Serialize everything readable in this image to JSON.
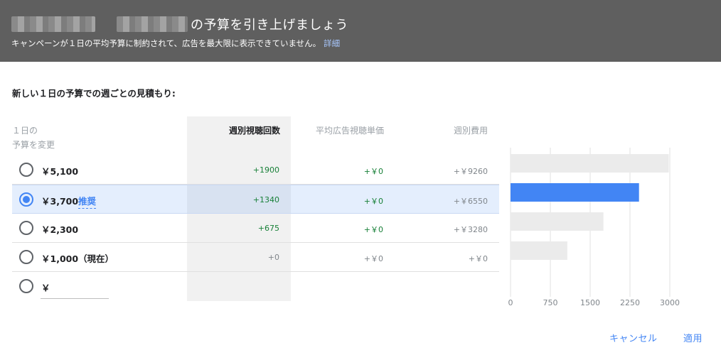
{
  "header": {
    "title": "の予算を引き上げましょう",
    "subtitle": "キャンペーンが１日の平均予算に制約されて、広告を最大限に表示できていません。",
    "details_link": "詳細"
  },
  "section_title": "新しい１日の予算での週ごとの見積もり:",
  "table": {
    "col_budget_line1": "１日の",
    "col_budget_line2": "予算を変更",
    "col_views": "週別視聴回数",
    "col_cpv": "平均広告視聴単価",
    "col_cost": "週別費用",
    "rows": [
      {
        "budget": "￥5,100",
        "views": "+1900",
        "cpv": "+￥0",
        "cost": "+￥9260",
        "selected": false,
        "recommended": ""
      },
      {
        "budget": "￥3,700",
        "views": "+1340",
        "cpv": "+￥0",
        "cost": "+￥6550",
        "selected": true,
        "recommended": "推奨"
      },
      {
        "budget": "￥2,300",
        "views": "+675",
        "cpv": "+￥0",
        "cost": "+￥3280",
        "selected": false,
        "recommended": ""
      },
      {
        "budget": "￥1,000（現在）",
        "views": "+0",
        "cpv": "+￥0",
        "cost": "+￥0",
        "selected": false,
        "recommended": ""
      }
    ],
    "custom_currency": "￥",
    "custom_value": ""
  },
  "chart_data": {
    "type": "bar",
    "orientation": "horizontal",
    "categories": [
      "￥5,100",
      "￥3,700",
      "￥2,300",
      "￥1,000（現在）"
    ],
    "values": [
      2980,
      2420,
      1750,
      1070
    ],
    "xlim": [
      0,
      3000
    ],
    "xticks": [
      "0",
      "750",
      "1500",
      "2250",
      "3000"
    ],
    "grid": true,
    "colors": {
      "default": "#ebebeb",
      "selected": "#4285f4"
    },
    "selected_index": 1
  },
  "footer": {
    "cancel": "キャンセル",
    "apply": "適用"
  }
}
